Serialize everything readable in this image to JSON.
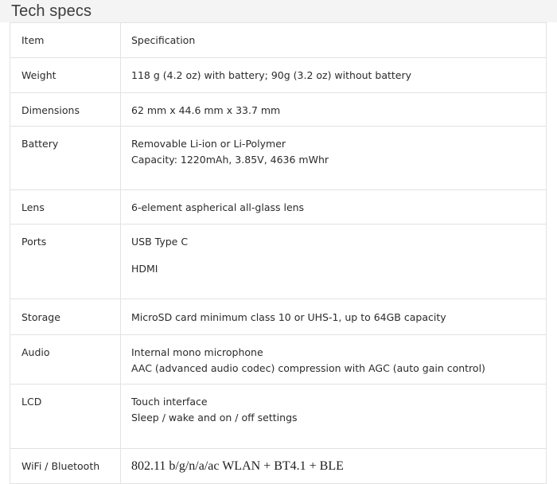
{
  "heading": {
    "title": "Tech specs"
  },
  "table": {
    "header": {
      "item": "Item",
      "specification": "Specification"
    },
    "rows": [
      {
        "item": "Weight",
        "lines": [
          "118 g (4.2 oz) with battery; 90g (3.2 oz) without battery"
        ]
      },
      {
        "item": "Dimensions",
        "lines": [
          "62 mm x 44.6 mm x 33.7 mm"
        ]
      },
      {
        "item": "Battery",
        "lines": [
          "Removable Li-ion or Li-Polymer",
          "Capacity: 1220mAh, 3.85V, 4636 mWhr"
        ]
      },
      {
        "item": "Lens",
        "lines": [
          "6-element aspherical all-glass lens"
        ]
      },
      {
        "item": "Ports",
        "lines": [
          "USB Type C",
          "HDMI"
        ]
      },
      {
        "item": "Storage",
        "lines": [
          "MicroSD card minimum class 10 or UHS-1, up to 64GB capacity"
        ]
      },
      {
        "item": "Audio",
        "lines": [
          "Internal mono microphone",
          "AAC (advanced audio codec) compression with AGC (auto gain control)"
        ]
      },
      {
        "item": "LCD",
        "lines": [
          "Touch interface",
          "Sleep / wake and on / off settings"
        ]
      },
      {
        "item": "WiFi / Bluetooth",
        "lines": [
          "802.11 b/g/n/a/ac WLAN + BT4.1 + BLE"
        ]
      }
    ]
  },
  "colors": {
    "heading_band": "#f4f4f4",
    "heading_text": "#3d3d3d",
    "border": "#e2e2e2",
    "body_text": "#2b2b2b",
    "page_background": "#ffffff"
  }
}
